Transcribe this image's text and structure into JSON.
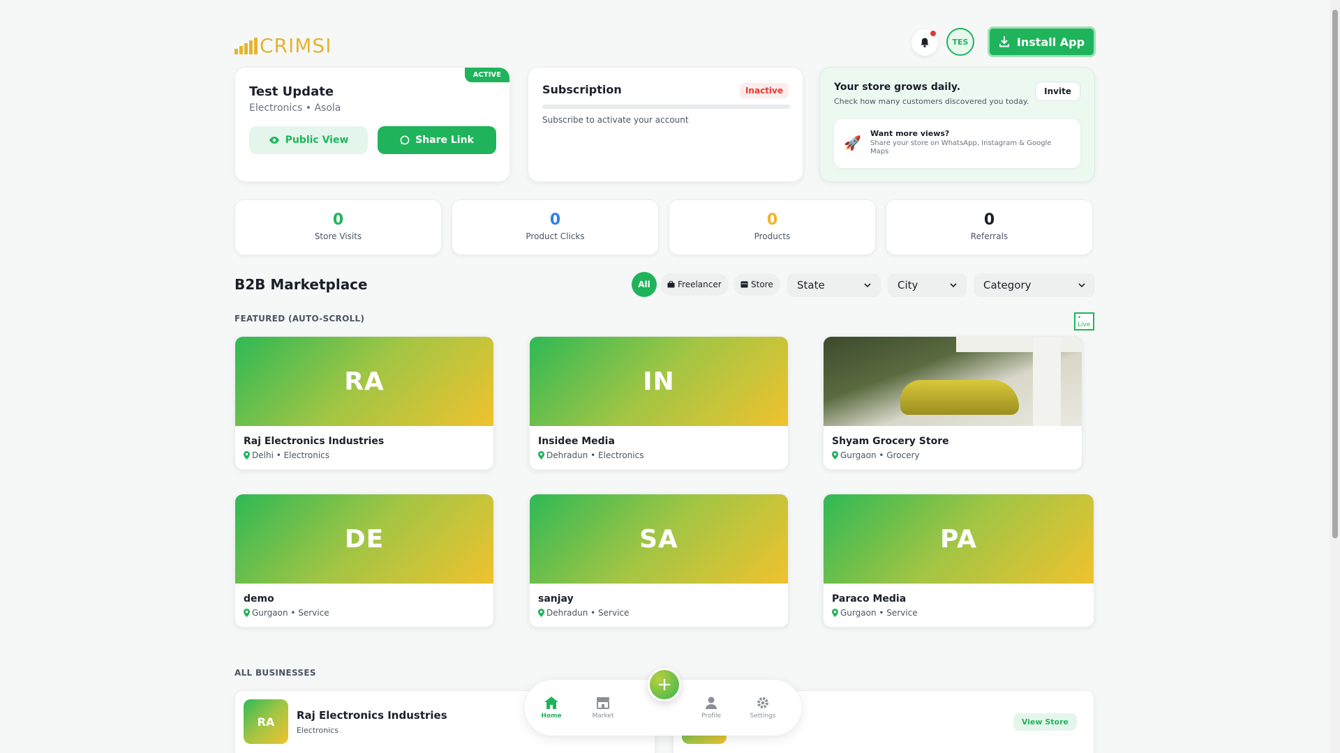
{
  "header": {
    "logo_text": "CRIMSI",
    "avatar_initials": "TES",
    "install_label": "Install App"
  },
  "store_card": {
    "badge": "ACTIVE",
    "title": "Test Update",
    "subtitle": "Electronics • Asola",
    "public_view_label": "Public View",
    "share_link_label": "Share Link"
  },
  "subscription": {
    "title": "Subscription",
    "status": "Inactive",
    "note": "Subscribe to activate your account"
  },
  "growth": {
    "title": "Your store grows daily.",
    "subtitle": "Check how many customers discovered you today.",
    "invite_label": "Invite",
    "tip_title": "Want more views?",
    "tip_text": "Share your store on WhatsApp, Instagram & Google Maps"
  },
  "stats": [
    {
      "value": "0",
      "label": "Store Visits",
      "color": "#1fb45b"
    },
    {
      "value": "0",
      "label": "Product Clicks",
      "color": "#2f80ed"
    },
    {
      "value": "0",
      "label": "Products",
      "color": "#f0b429"
    },
    {
      "value": "0",
      "label": "Referrals",
      "color": "#1b1f2a"
    }
  ],
  "marketplace": {
    "title": "B2B Marketplace",
    "filters": {
      "all": "All",
      "freelancer": "Freelancer",
      "store": "Store"
    },
    "selects": {
      "state": "State",
      "city": "City",
      "category": "Category"
    },
    "featured_label": "FEATURED (AUTO-SCROLL)",
    "live_label": "• Live",
    "all_label": "ALL BUSINESSES"
  },
  "featured": [
    {
      "initials": "RA",
      "name": "Raj Electronics Industries",
      "location": "Delhi • Electronics"
    },
    {
      "initials": "IN",
      "name": "Insidee Media",
      "location": "Dehradun • Electronics"
    },
    {
      "initials": "",
      "name": "Shyam Grocery Store",
      "location": "Gurgaon • Grocery"
    },
    {
      "initials": "DE",
      "name": "demo",
      "location": "Gurgaon • Service"
    },
    {
      "initials": "SA",
      "name": "sanjay",
      "location": "Dehradun • Service"
    },
    {
      "initials": "PA",
      "name": "Paraco Media",
      "location": "Gurgaon • Service"
    }
  ],
  "all_businesses": [
    {
      "initials": "RA",
      "name": "Raj Electronics Industries",
      "category": "Electronics"
    },
    {
      "view_label": "View Store"
    }
  ],
  "bottom_nav": {
    "home": "Home",
    "market": "Market",
    "profile": "Profile",
    "settings": "Settings",
    "fab": "+"
  },
  "colors": {
    "brand_green": "#1fb45b",
    "logo_gold": "#e3b530",
    "inactive_red": "#e53935"
  }
}
